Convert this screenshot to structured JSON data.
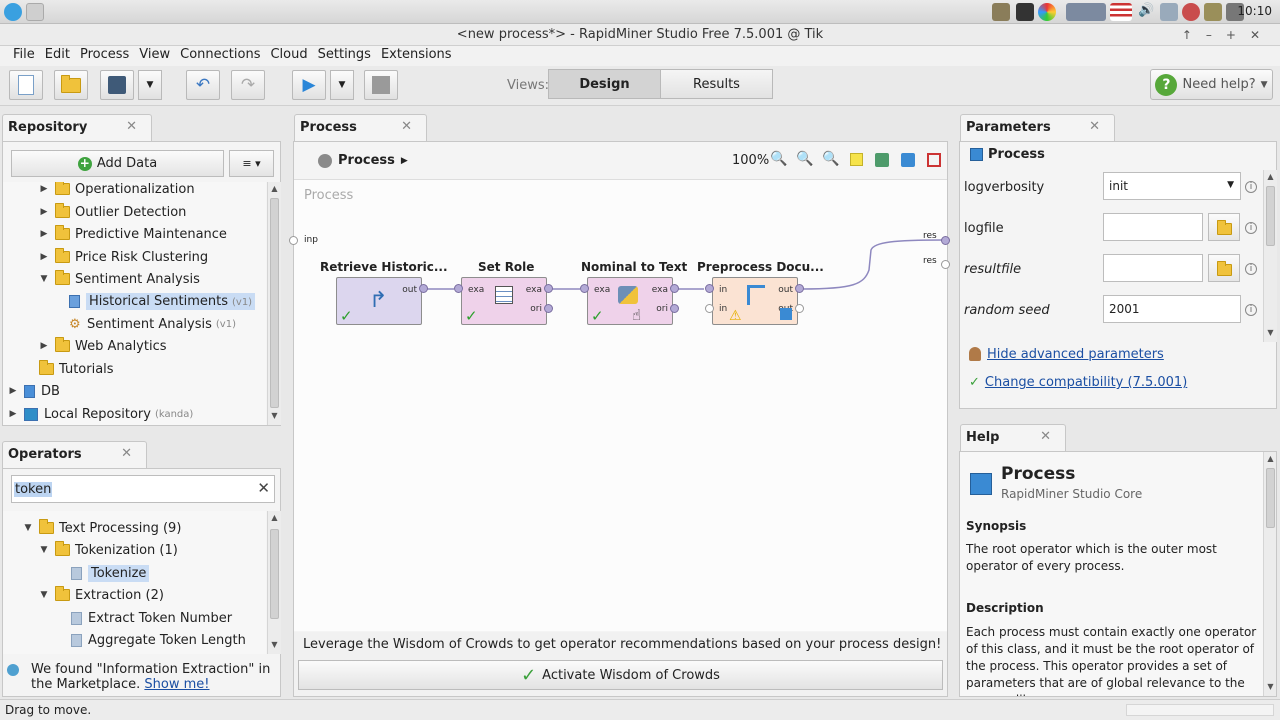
{
  "os": {
    "clock": "10:10"
  },
  "window": {
    "title": "<new process*> - RapidMiner Studio Free 7.5.001 @ Tik"
  },
  "menu": [
    "File",
    "Edit",
    "Process",
    "View",
    "Connections",
    "Cloud",
    "Settings",
    "Extensions"
  ],
  "toolbar": {
    "views_label": "Views:",
    "design_label": "Design",
    "results_label": "Results",
    "help_label": "Need help?"
  },
  "repository": {
    "tab": "Repository",
    "add_data": "Add Data",
    "items": [
      {
        "label": "Operationalization",
        "type": "folder",
        "arrow": "▶"
      },
      {
        "label": "Outlier Detection",
        "type": "folder",
        "arrow": "▶"
      },
      {
        "label": "Predictive Maintenance",
        "type": "folder",
        "arrow": "▶"
      },
      {
        "label": "Price Risk Clustering",
        "type": "folder",
        "arrow": "▶"
      },
      {
        "label": "Sentiment Analysis",
        "type": "folder",
        "arrow": "▼"
      },
      {
        "label": "Historical Sentiments",
        "type": "data",
        "version": "(v1)"
      },
      {
        "label": "Sentiment Analysis",
        "type": "process",
        "version": "(v1)"
      },
      {
        "label": "Web Analytics",
        "type": "folder",
        "arrow": "▶"
      },
      {
        "label": "Tutorials",
        "type": "folder"
      },
      {
        "label": "DB",
        "type": "db",
        "arrow": "▶"
      },
      {
        "label": "Local Repository",
        "type": "local",
        "arrow": "▶",
        "tag": "(kanda)"
      }
    ]
  },
  "operators": {
    "tab": "Operators",
    "search_value": "token",
    "items": [
      {
        "label": "Text Processing (9)",
        "type": "folder",
        "arrow": "▼"
      },
      {
        "label": "Tokenization (1)",
        "type": "folder",
        "arrow": "▼"
      },
      {
        "label": "Tokenize",
        "type": "op"
      },
      {
        "label": "Extraction (2)",
        "type": "folder",
        "arrow": "▼"
      },
      {
        "label": "Extract Token Number",
        "type": "op"
      },
      {
        "label": "Aggregate Token Length",
        "type": "op"
      }
    ],
    "market_text": "We found \"Information Extraction\" in the Marketplace.",
    "market_link": "Show me!"
  },
  "process": {
    "tab": "Process",
    "breadcrumb": "Process",
    "zoom": "100%",
    "canvas_label": "Process",
    "input_port": "inp",
    "output_ports": [
      "res",
      "res"
    ],
    "operators": [
      {
        "title": "Retrieve Historic...",
        "ports_in": [],
        "ports_out": [
          "out"
        ],
        "status": "ok"
      },
      {
        "title": "Set Role",
        "ports_in": [
          "exa"
        ],
        "ports_out": [
          "exa",
          "ori"
        ],
        "status": "ok"
      },
      {
        "title": "Nominal to Text",
        "ports_in": [
          "exa"
        ],
        "ports_out": [
          "exa",
          "ori"
        ],
        "status": "ok"
      },
      {
        "title": "Preprocess Docu...",
        "ports_in": [
          "in",
          "in"
        ],
        "ports_out": [
          "out",
          "out"
        ],
        "status": "warning"
      }
    ],
    "wisdom_text": "Leverage the Wisdom of Crowds to get operator recommendations based on your process design!",
    "wisdom_button": "Activate Wisdom of Crowds"
  },
  "parameters": {
    "tab": "Parameters",
    "header": "Process",
    "rows": [
      {
        "name": "logverbosity",
        "value": "init"
      },
      {
        "name": "logfile",
        "value": ""
      },
      {
        "name": "resultfile",
        "value": ""
      },
      {
        "name": "random seed",
        "value": "2001"
      }
    ],
    "hide_advanced": "Hide advanced parameters",
    "compat": "Change compatibility (7.5.001)"
  },
  "help": {
    "tab": "Help",
    "title": "Process",
    "subtitle": "RapidMiner Studio Core",
    "synopsis_h": "Synopsis",
    "synopsis": "The root operator which is the outer most operator of every process.",
    "description_h": "Description",
    "description": "Each process must contain exactly one operator of this class, and it must be the root operator of the process. This operator provides a set of parameters that are of global relevance to the process like"
  },
  "status": {
    "text": "Drag to move."
  }
}
